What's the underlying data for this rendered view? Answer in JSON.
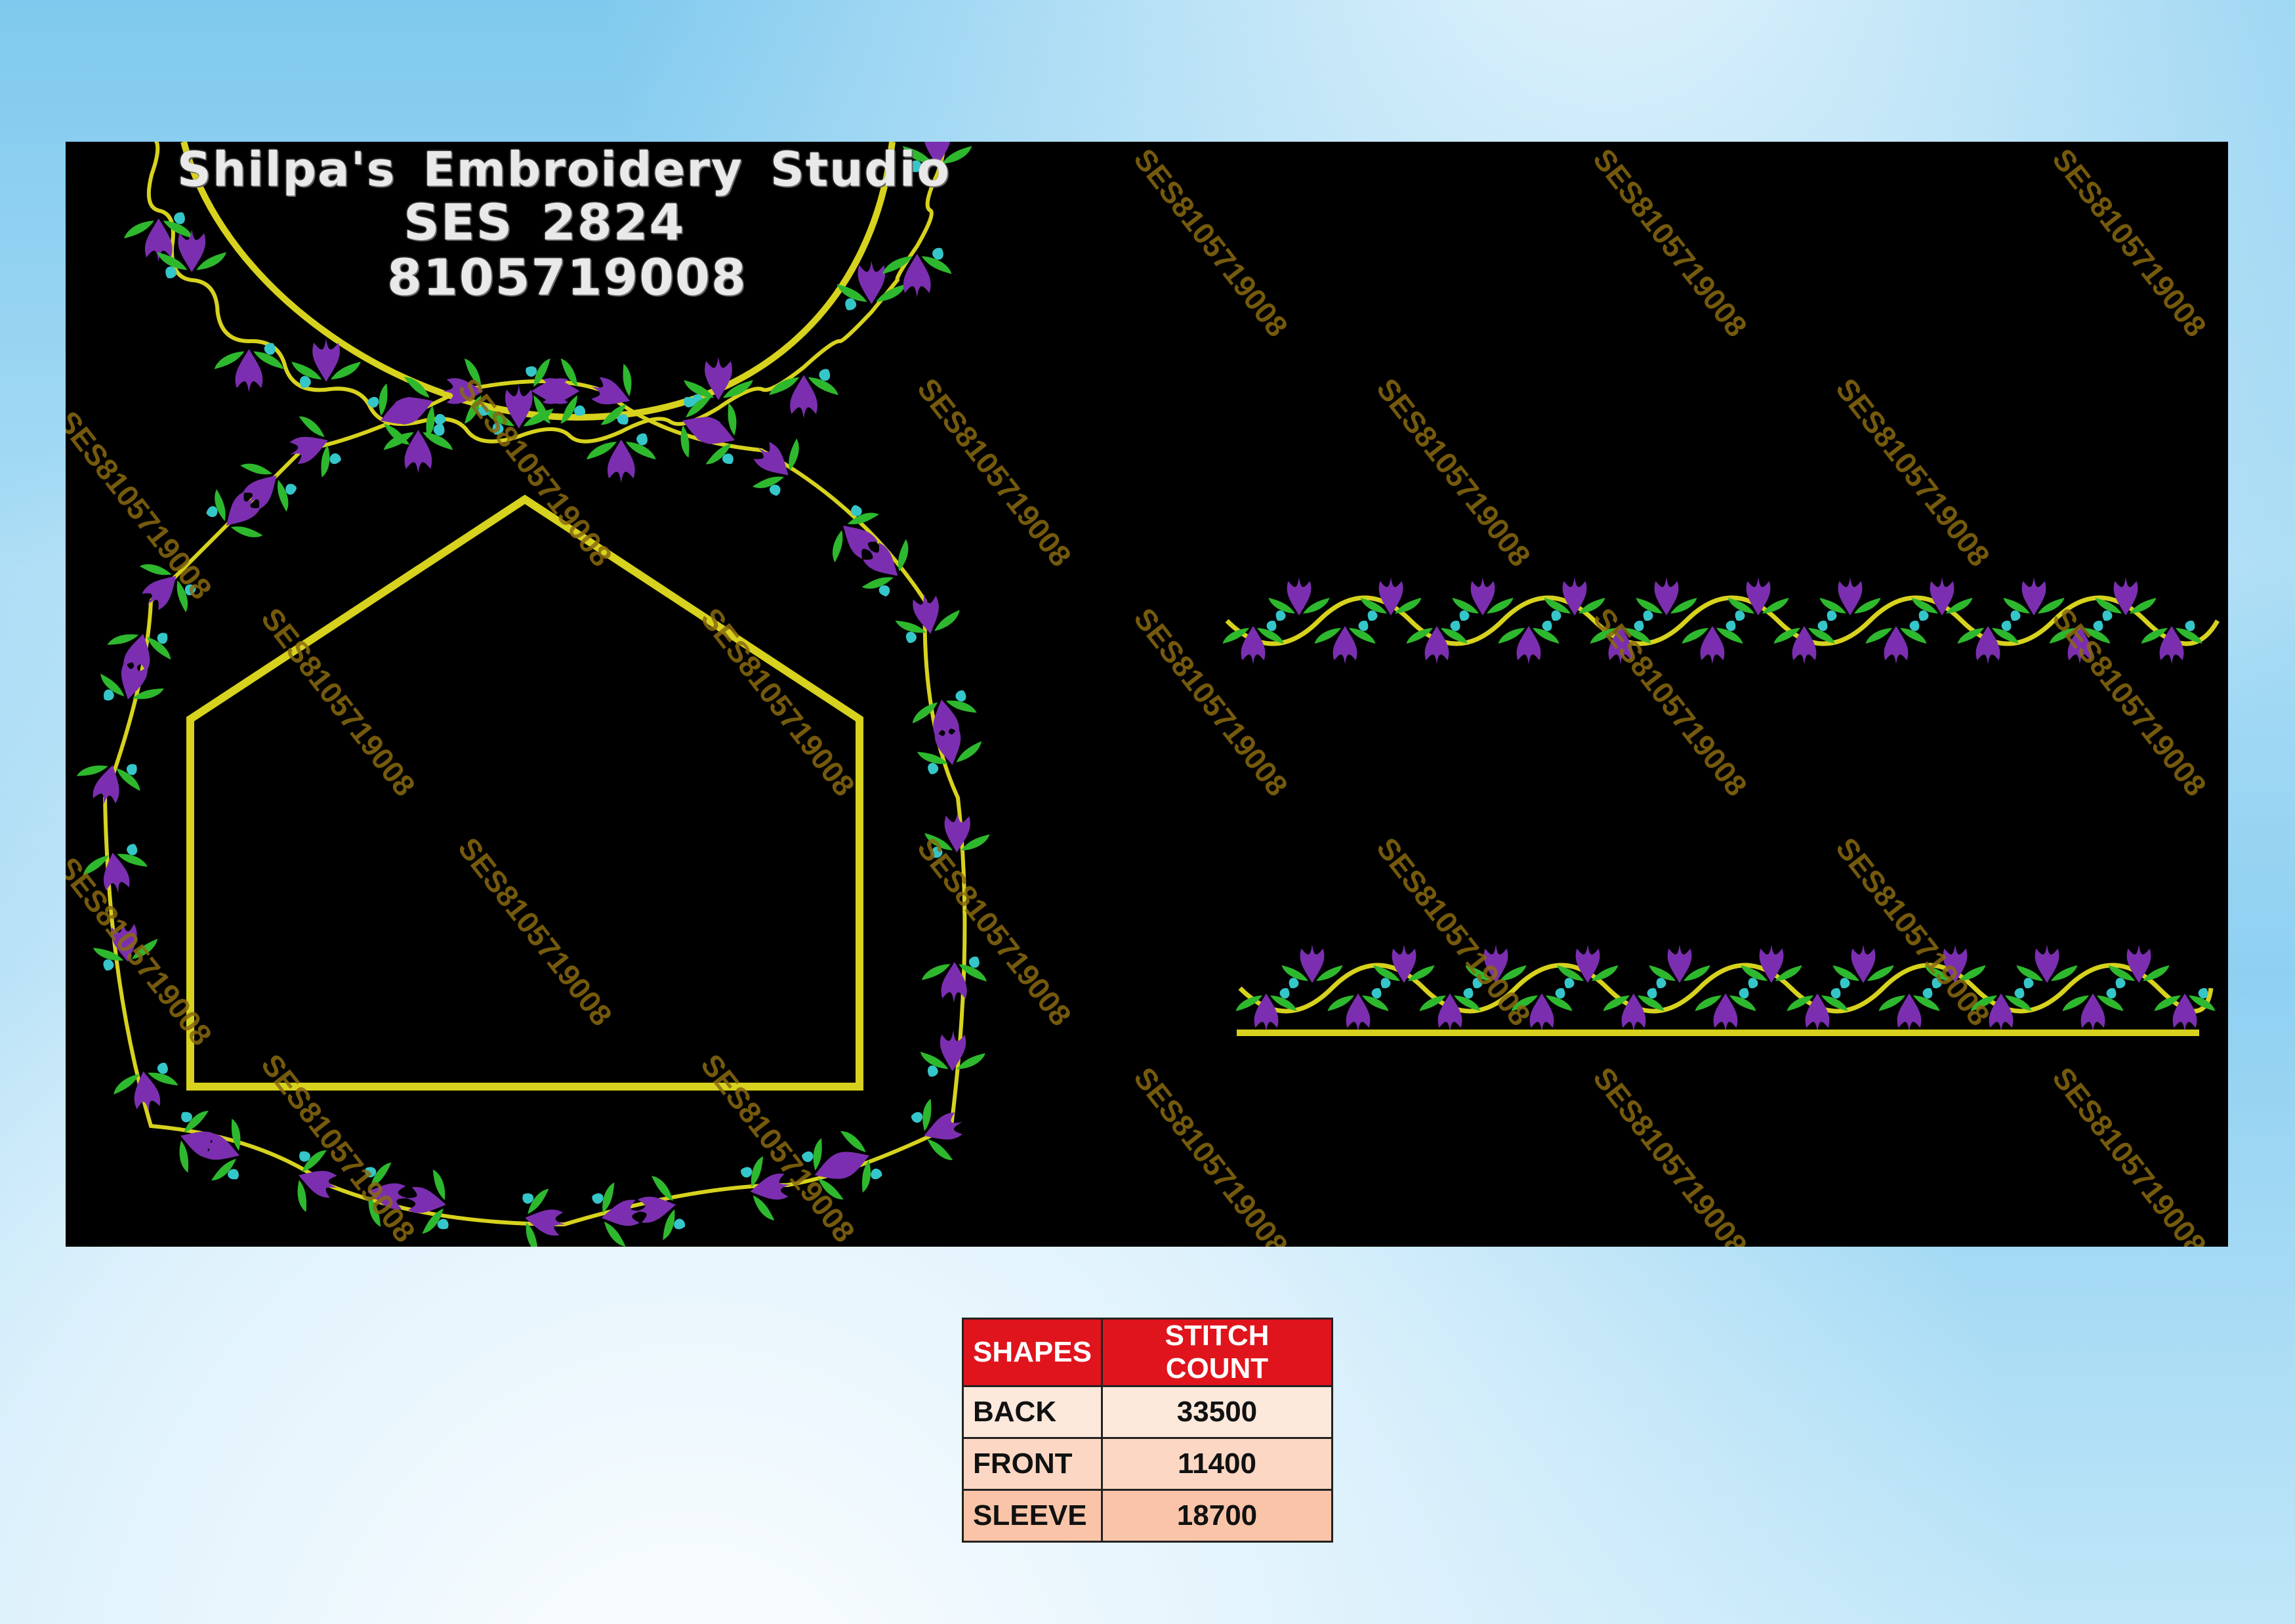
{
  "header": {
    "studio_name": "Shilpa's Embroidery Studio",
    "design_code": "SES 2824",
    "phone": "8105719008"
  },
  "watermark": "SES8105719008",
  "colors": {
    "background": "#000000",
    "outline": "#d7d21e",
    "petal": "#7b2fb0",
    "leaf": "#2eb82e",
    "bud": "#35c6c9",
    "table_header": "#e0141c"
  },
  "table": {
    "headers": [
      "SHAPES",
      "STITCH COUNT"
    ],
    "rows": [
      {
        "shape": "BACK",
        "count": "33500"
      },
      {
        "shape": "FRONT",
        "count": "11400"
      },
      {
        "shape": "SLEEVE",
        "count": "18700"
      }
    ]
  }
}
